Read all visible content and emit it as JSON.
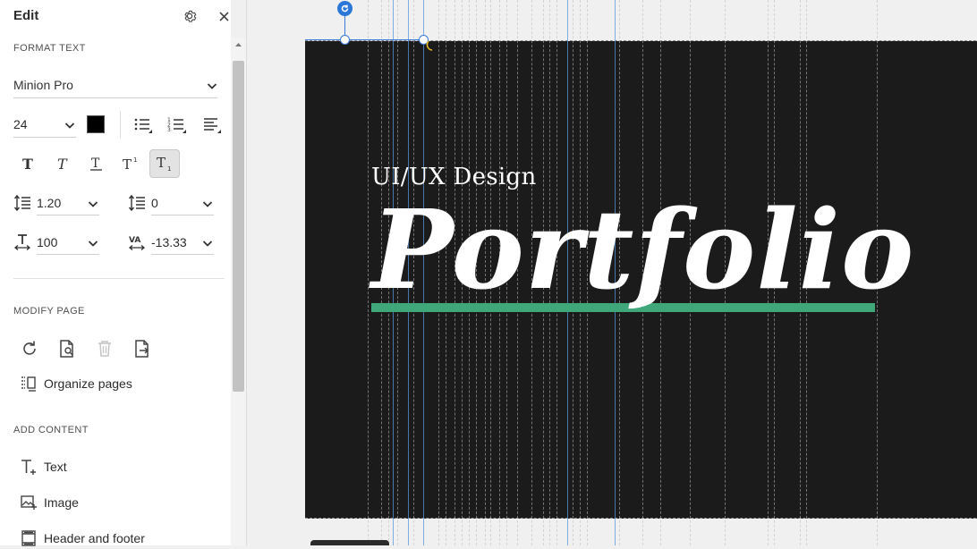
{
  "panel": {
    "title": "Edit",
    "format_text": {
      "section_label": "FORMAT TEXT",
      "font_family": "Minion Pro",
      "font_size": "24",
      "text_color": "#000000",
      "line_spacing": "1.20",
      "paragraph_spacing": "0",
      "horizontal_scale": "100",
      "char_spacing": "-13.33"
    },
    "modify_page": {
      "section_label": "MODIFY PAGE",
      "organize_label": "Organize pages"
    },
    "add_content": {
      "section_label": "ADD CONTENT",
      "items": [
        {
          "label": "Text"
        },
        {
          "label": "Image"
        },
        {
          "label": "Header and footer"
        }
      ]
    }
  },
  "document": {
    "subtitle": "UI/UX Design",
    "title": "Portfolio",
    "page_color": "#1b1b1b",
    "accent_color": "#3fa77a",
    "selection_color": "#3a7ad8"
  }
}
